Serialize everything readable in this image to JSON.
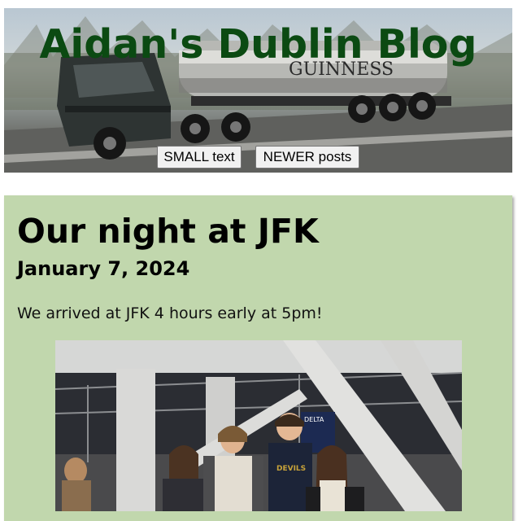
{
  "header": {
    "title": "Aidan's Dublin Blog",
    "small_text_button": "SMALL text",
    "newer_posts_button": "NEWER posts",
    "truck_brand": "GUINNESS",
    "colors": {
      "title": "#0b4a12",
      "button_bg": "#f1f1f1"
    }
  },
  "post": {
    "title": "Our night at JFK",
    "date": "January 7, 2024",
    "text": "We arrived at JFK 4 hours early at 5pm!",
    "photo_sign": "DELTA",
    "colors": {
      "card_bg": "#c1d7ad"
    }
  }
}
